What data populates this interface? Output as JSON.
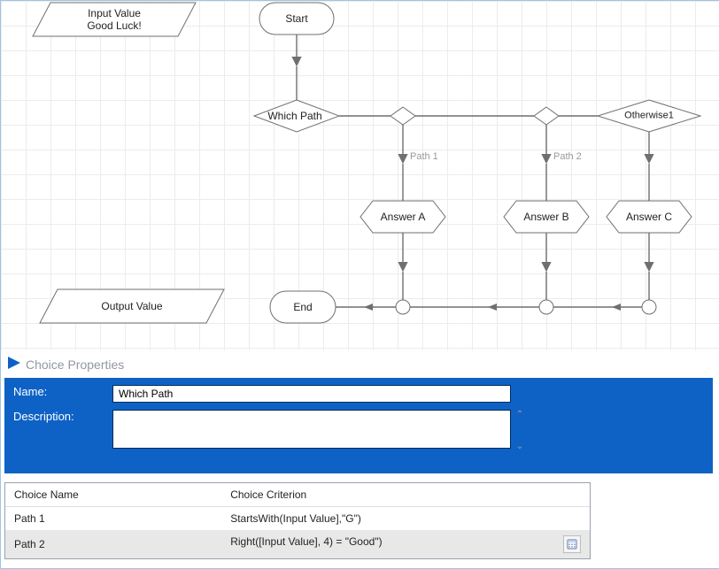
{
  "flowchart": {
    "input_value_line1": "Input Value",
    "input_value_line2": "Good Luck!",
    "start": "Start",
    "which_path": "Which Path",
    "otherwise": "Otherwise1",
    "path1_label": "Path 1",
    "path2_label": "Path 2",
    "answer_a": "Answer A",
    "answer_b": "Answer B",
    "answer_c": "Answer C",
    "output_value": "Output Value",
    "end": "End"
  },
  "properties": {
    "panel_title": "Choice Properties",
    "name_label": "Name:",
    "name_value": "Which Path",
    "description_label": "Description:",
    "description_value": ""
  },
  "choice_table": {
    "col_name": "Choice Name",
    "col_criterion": "Choice Criterion",
    "rows": [
      {
        "name": "Path 1",
        "criterion": "StartsWith(Input Value],\"G\")"
      },
      {
        "name": "Path 2",
        "criterion": "Right([Input Value], 4) = \"Good\")"
      }
    ],
    "selected_index": 1
  }
}
